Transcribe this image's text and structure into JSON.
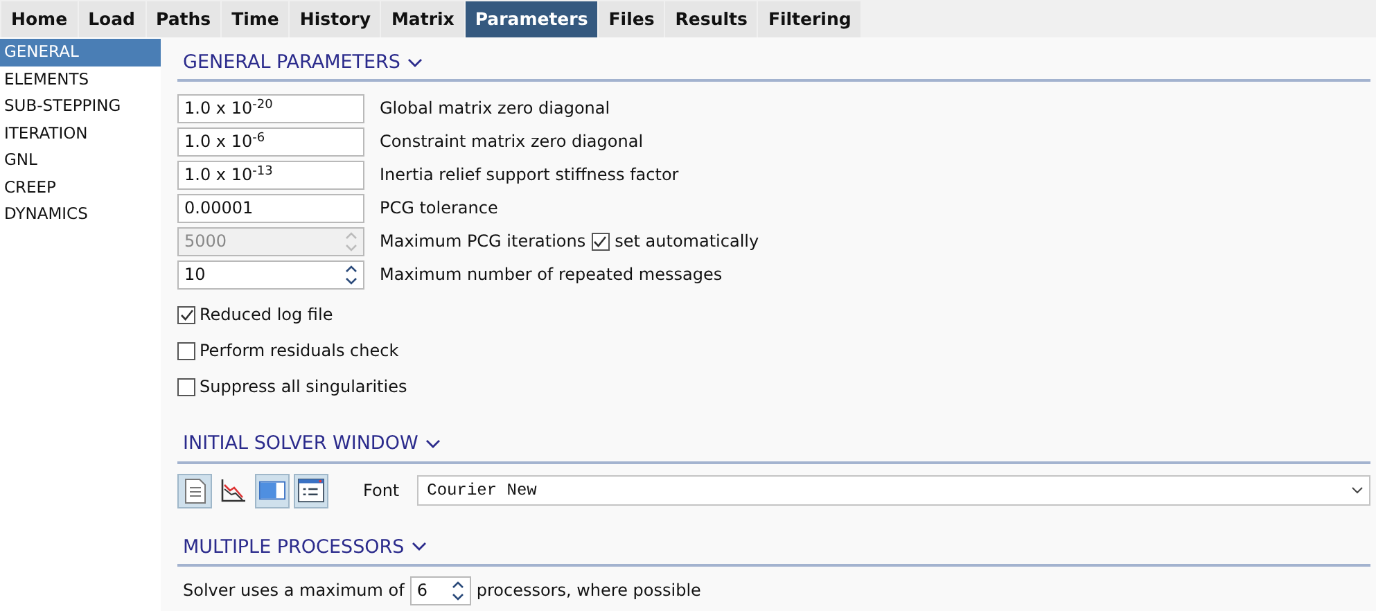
{
  "tabs": [
    {
      "label": "Home",
      "selected": false
    },
    {
      "label": "Load",
      "selected": false
    },
    {
      "label": "Paths",
      "selected": false
    },
    {
      "label": "Time",
      "selected": false
    },
    {
      "label": "History",
      "selected": false
    },
    {
      "label": "Matrix",
      "selected": false
    },
    {
      "label": "Parameters",
      "selected": true
    },
    {
      "label": "Files",
      "selected": false
    },
    {
      "label": "Results",
      "selected": false
    },
    {
      "label": "Filtering",
      "selected": false
    }
  ],
  "sidebar": {
    "items": [
      {
        "label": "GENERAL",
        "selected": true
      },
      {
        "label": "ELEMENTS",
        "selected": false
      },
      {
        "label": "SUB-STEPPING",
        "selected": false
      },
      {
        "label": "ITERATION",
        "selected": false
      },
      {
        "label": "GNL",
        "selected": false
      },
      {
        "label": "CREEP",
        "selected": false
      },
      {
        "label": "DYNAMICS",
        "selected": false
      }
    ]
  },
  "general": {
    "title": "GENERAL PARAMETERS",
    "expanded": true,
    "fields": [
      {
        "kind": "text",
        "value": "1.0 x 10$^{-20}$",
        "label": "Global matrix zero diagonal",
        "disabled": false
      },
      {
        "kind": "text",
        "value": "1.0 x 10$^{-6}$",
        "label": "Constraint matrix zero diagonal",
        "disabled": false
      },
      {
        "kind": "text",
        "value": "1.0 x 10$^{-13}$",
        "label": "Inertia relief support stiffness factor",
        "disabled": false
      },
      {
        "kind": "text",
        "value": "0.00001",
        "label": "PCG tolerance",
        "disabled": false
      },
      {
        "kind": "spin",
        "value": "5000",
        "label": "Maximum PCG iterations",
        "disabled": true,
        "option": {
          "label": "set automatically",
          "checked": true
        }
      },
      {
        "kind": "spin",
        "value": "10",
        "label": "Maximum number of repeated messages",
        "disabled": false
      }
    ],
    "checkboxes": [
      {
        "label": "Reduced log file",
        "checked": true
      },
      {
        "label": "Perform residuals check",
        "checked": false
      },
      {
        "label": "Suppress all singularities",
        "checked": false
      }
    ]
  },
  "solver_window": {
    "title": "INITIAL SOLVER WINDOW",
    "expanded": true,
    "tools": [
      {
        "kind": "document",
        "selected": true
      },
      {
        "kind": "graph",
        "selected": false
      },
      {
        "kind": "panel",
        "selected": true
      },
      {
        "kind": "list",
        "selected": true
      }
    ],
    "font_label": "Font",
    "font_value": "Courier New"
  },
  "processors": {
    "title": "MULTIPLE PROCESSORS",
    "expanded": true,
    "prefix": "Solver uses a maximum of",
    "value": "6",
    "suffix": "processors, where possible"
  }
}
